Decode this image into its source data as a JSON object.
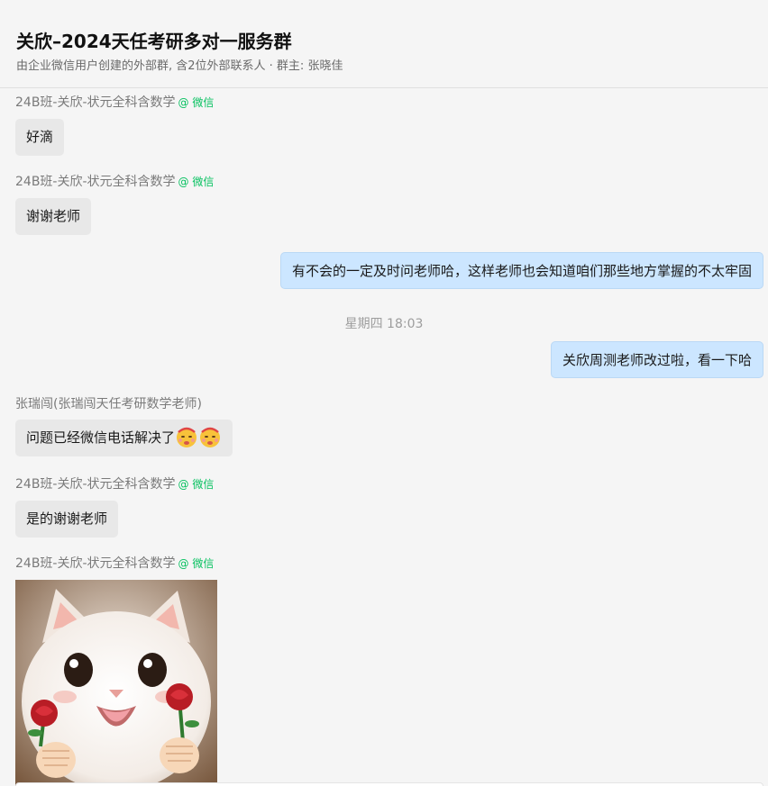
{
  "header": {
    "title": "关欣–2024天任考研多对一服务群",
    "subtitle": "由企业微信用户创建的外部群, 含2位外部联系人 · 群主: 张晓佳"
  },
  "messages": [
    {
      "sender": "24B班-关欣-状元全科含数学",
      "wechat_tag": "@ 微信",
      "text": "好滴"
    },
    {
      "sender": "24B班-关欣-状元全科含数学",
      "wechat_tag": "@ 微信",
      "text": "谢谢老师"
    },
    {
      "text": "有不会的一定及时问老师哈，这样老师也会知道咱们那些地方掌握的不太牢固"
    },
    {
      "time": "星期四 18:03"
    },
    {
      "text": "关欣周测老师改过啦，看一下哈"
    },
    {
      "sender": "张瑞闯(张瑞闯天任考研数学老师)",
      "text": "问题已经微信电话解决了",
      "emoji": "kiss-emoji"
    },
    {
      "sender": "24B班-关欣-状元全科含数学",
      "wechat_tag": "@ 微信",
      "text": "是的谢谢老师"
    },
    {
      "sender": "24B班-关欣-状元全科含数学",
      "wechat_tag": "@ 微信",
      "image": "cat-with-roses-sticker"
    }
  ],
  "colors": {
    "background": "#f5f5f5",
    "incoming_bubble": "#e8e8e8",
    "outgoing_bubble": "#cce6ff",
    "wechat_tag": "#07c160"
  }
}
